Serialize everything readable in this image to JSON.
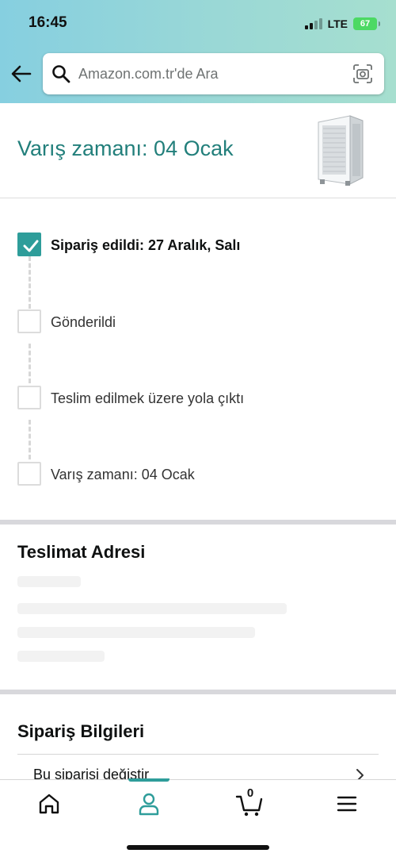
{
  "status_bar": {
    "time": "16:45",
    "network": "LTE",
    "battery": "67"
  },
  "header": {
    "search_placeholder": "Amazon.com.tr'de Ara"
  },
  "arrival": {
    "title": "Varış zamanı: 04 Ocak"
  },
  "tracker": {
    "steps": [
      {
        "label": "Sipariş edildi: 27 Aralık, Salı",
        "completed": true
      },
      {
        "label": "Gönderildi",
        "completed": false
      },
      {
        "label": "Teslim edilmek üzere yola çıktı",
        "completed": false
      },
      {
        "label": "Varış zamanı: 04 Ocak",
        "completed": false
      }
    ]
  },
  "address": {
    "title": "Teslimat Adresi"
  },
  "order_info": {
    "title": "Sipariş Bilgileri",
    "rows": [
      {
        "label": "Bu siparişi değiştir"
      }
    ]
  },
  "bottom_nav": {
    "cart_count": "0",
    "items": [
      "home",
      "account",
      "cart",
      "menu"
    ],
    "active": "account"
  },
  "colors": {
    "accent": "#2e9d9a",
    "title_teal": "#227f7b"
  }
}
